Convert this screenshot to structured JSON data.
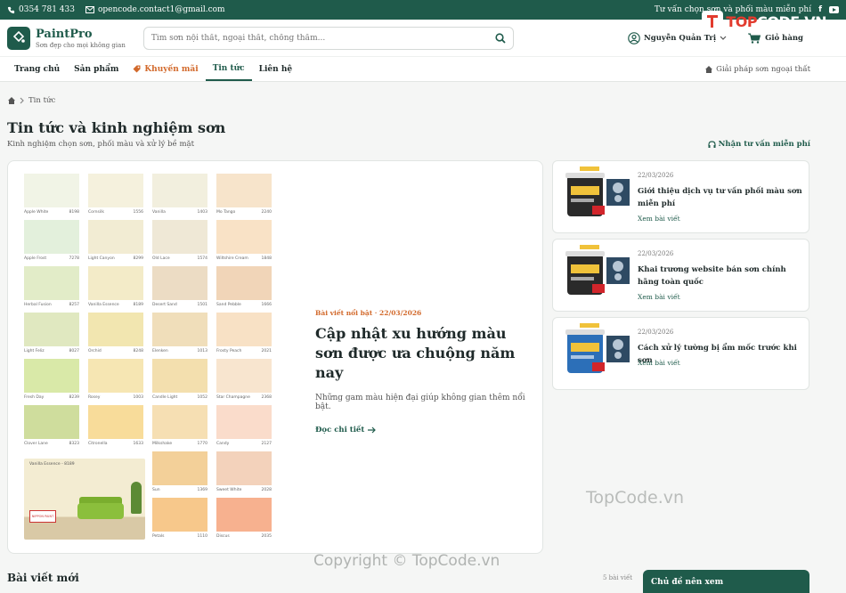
{
  "topbar": {
    "phone": "0354 781 433",
    "email": "opencode.contact1@gmail.com",
    "advice": "Tư vấn chọn sơn và phối màu miễn phí"
  },
  "header": {
    "brand": "PaintPro",
    "tagline": "Sơn đẹp cho mọi không gian",
    "search_placeholder": "Tìm sơn nội thất, ngoại thất, chống thấm...",
    "user_name": "Nguyễn Quản Trị",
    "cart_label": "Giỏ hàng"
  },
  "nav": {
    "items": [
      "Trang chủ",
      "Sản phẩm",
      "Khuyến mãi",
      "Tin tức",
      "Liên hệ"
    ],
    "active": "Tin tức",
    "solution": "Giải pháp sơn ngoại thất"
  },
  "breadcrumb": {
    "current": "Tin tức"
  },
  "page": {
    "title": "Tin tức và kinh nghiệm sơn",
    "subtitle": "Kinh nghiệm chọn sơn, phối màu và xử lý bề mặt",
    "consult": "Nhận tư vấn miễn phí"
  },
  "featured": {
    "meta": "Bài viết nổi bật · 22/03/2026",
    "title": "Cập nhật xu hướng màu sơn được ưa chuộng năm nay",
    "desc": "Những gam màu hiện đại giúp không gian thêm nổi bật.",
    "link": "Đọc chi tiết",
    "swatches": [
      {
        "name": "Apple White",
        "code": "8198",
        "color": "#f1f4e6"
      },
      {
        "name": "Cornsilk",
        "code": "1556",
        "color": "#f5f1dd"
      },
      {
        "name": "Vanilla",
        "code": "1403",
        "color": "#f2efde"
      },
      {
        "name": "Mo Tango",
        "code": "2240",
        "color": "#f7e4cb"
      },
      {
        "name": "Apple Frost",
        "code": "7278",
        "color": "#e3f0dc"
      },
      {
        "name": "Light Canyon",
        "code": "8299",
        "color": "#f2ecd3"
      },
      {
        "name": "Old Lace",
        "code": "1574",
        "color": "#efe8d6"
      },
      {
        "name": "Wiltshire Cream",
        "code": "1848",
        "color": "#f9e2c6"
      },
      {
        "name": "Herbal Fusion",
        "code": "8257",
        "color": "#e2ecc8"
      },
      {
        "name": "Vanilla Essence",
        "code": "8189",
        "color": "#f3ebc8"
      },
      {
        "name": "Desert Sand",
        "code": "1501",
        "color": "#ecdcc4"
      },
      {
        "name": "Sand Pebble",
        "code": "1666",
        "color": "#f1d5b8"
      },
      {
        "name": "Light Feliz",
        "code": "8027",
        "color": "#e0e8c0"
      },
      {
        "name": "Orchid",
        "code": "8248",
        "color": "#f2e6b0"
      },
      {
        "name": "Elenken",
        "code": "1013",
        "color": "#f0deba"
      },
      {
        "name": "Frosty Peach",
        "code": "2021",
        "color": "#f8e1c5"
      },
      {
        "name": "Fresh Day",
        "code": "8239",
        "color": "#d9e9a8"
      },
      {
        "name": "Rosey",
        "code": "1003",
        "color": "#f6e6b3"
      },
      {
        "name": "Candle Light",
        "code": "1052",
        "color": "#f3dfae"
      },
      {
        "name": "Star Champagne",
        "code": "2368",
        "color": "#f8e5cf"
      },
      {
        "name": "Clover Lane",
        "code": "8323",
        "color": "#cfdd9d"
      },
      {
        "name": "Citronella",
        "code": "1633",
        "color": "#f8dc9a"
      },
      {
        "name": "Milkshake",
        "code": "1770",
        "color": "#f6dfb3"
      },
      {
        "name": "Candy",
        "code": "2127",
        "color": "#fadccb"
      },
      {
        "name": "Sun",
        "code": "1369",
        "color": "#f3d099"
      },
      {
        "name": "Sweet White",
        "code": "2028",
        "color": "#f3d2bb"
      },
      {
        "name": "Petals",
        "code": "1110",
        "color": "#f7c88b"
      },
      {
        "name": "Discus",
        "code": "2035",
        "color": "#f7b18f"
      }
    ],
    "room_label": "Vanilla Essence - 8189",
    "room_brand": "NIPPON PAINT"
  },
  "side_posts": [
    {
      "date": "22/03/2026",
      "title": "Giới thiệu dịch vụ tư vấn phối màu sơn miễn phí",
      "link": "Xem bài viết",
      "product": "JOTUN"
    },
    {
      "date": "22/03/2026",
      "title": "Khai trương website bán sơn chính hãng toàn quốc",
      "link": "Xem bài viết",
      "product": "JOTUN"
    },
    {
      "date": "22/03/2026",
      "title": "Cách xử lý tường bị ẩm mốc trước khi sơn",
      "link": "Xem bài viết",
      "product": "JOTUN"
    }
  ],
  "bottom": {
    "latest": "Bài viết mới",
    "count": "5 bài viết",
    "topics": "Chủ đề nên xem"
  },
  "watermark": {
    "brand_top": "TOP",
    "brand_rest": "CODE.VN",
    "center": "TopCode.vn",
    "copyright": "Copyright © TopCode.vn"
  },
  "colors": {
    "primary": "#1f5b4b",
    "accent": "#d2692b"
  }
}
